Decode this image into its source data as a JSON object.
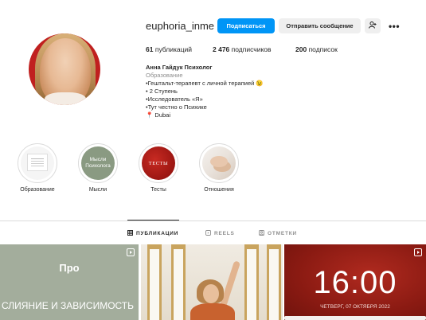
{
  "profile": {
    "username": "euphoria_inme",
    "follow_label": "Подписаться",
    "message_label": "Отправить сообщение",
    "suggest_icon": "person-add-icon",
    "more_label": "•••",
    "stats": {
      "posts_num": "61",
      "posts_text": "публикаций",
      "followers_num": "2 476",
      "followers_text": "подписчиков",
      "following_num": "200",
      "following_text": "подписок"
    },
    "bio": {
      "name": "Анна Гайдук Психолог",
      "category": "Образование",
      "lines": [
        "•Гештальт-терапевт с личной терапией 😉",
        "• 2 Ступень",
        "•Исследователь «Я»",
        "•Тут честно о Психике",
        "📍 Dubai"
      ]
    }
  },
  "highlights": [
    {
      "label": "Образование",
      "text": ""
    },
    {
      "label": "Мысли",
      "text": "Мысли Психолога"
    },
    {
      "label": "Тесты",
      "text": "ТЕСТЫ"
    },
    {
      "label": "Отношения",
      "text": ""
    }
  ],
  "tabs": {
    "posts": "ПУБЛИКАЦИИ",
    "reels": "REELS",
    "tagged": "ОТМЕТКИ"
  },
  "posts": {
    "p1": {
      "title": "Про",
      "subtitle": "СЛИЯНИЕ И ЗАВИСИМОСТЬ"
    },
    "p3": {
      "time": "16:00",
      "date": "ЧЕТВЕРГ, 07 ОКТЯБРЯ 2022"
    }
  },
  "colors": {
    "accent": "#0095f6",
    "text": "#262626",
    "muted": "#8e8e8e"
  }
}
